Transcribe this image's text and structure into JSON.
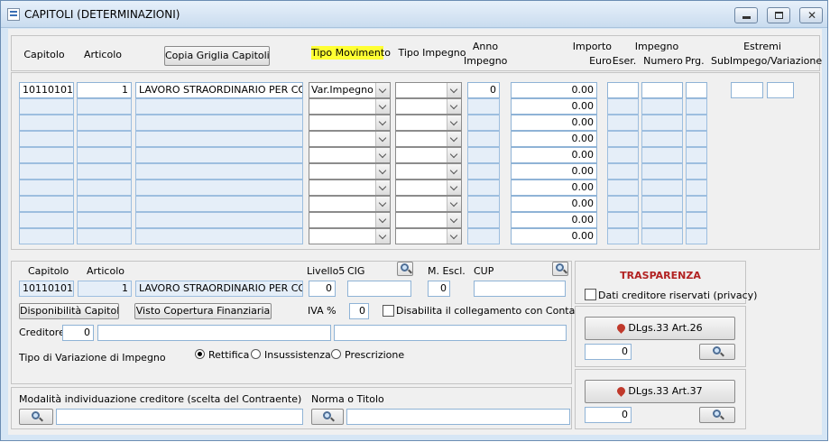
{
  "window": {
    "title": "CAPITOLI (DETERMINAZIONI)"
  },
  "grid_header": {
    "capitolo": "Capitolo",
    "articolo": "Articolo",
    "copia_btn": "Copia Griglia Capitoli",
    "tipo_movimento": "Tipo Movimento",
    "tipo_impegno": "Tipo Impegno",
    "anno": "Anno",
    "impegno": "Impegno",
    "importo": "Importo",
    "euro": "Euro",
    "impegno_group": "Impegno",
    "eser": "Eser.",
    "numero": "Numero",
    "prg": "Prg.",
    "estremi": "Estremi",
    "sub": "SubImpego/Variazione"
  },
  "grid_rows": [
    {
      "capitolo": "10110101",
      "articolo": "1",
      "descr": "LAVORO STRAORDINARIO PER CONS",
      "tipo_mov": "Var.Impegno",
      "tipo_imp": "",
      "anno": "0",
      "importo": "0.00"
    },
    {
      "capitolo": "",
      "articolo": "",
      "descr": "",
      "tipo_mov": "",
      "tipo_imp": "",
      "anno": "",
      "importo": "0.00"
    },
    {
      "capitolo": "",
      "articolo": "",
      "descr": "",
      "tipo_mov": "",
      "tipo_imp": "",
      "anno": "",
      "importo": "0.00"
    },
    {
      "capitolo": "",
      "articolo": "",
      "descr": "",
      "tipo_mov": "",
      "tipo_imp": "",
      "anno": "",
      "importo": "0.00"
    },
    {
      "capitolo": "",
      "articolo": "",
      "descr": "",
      "tipo_mov": "",
      "tipo_imp": "",
      "anno": "",
      "importo": "0.00"
    },
    {
      "capitolo": "",
      "articolo": "",
      "descr": "",
      "tipo_mov": "",
      "tipo_imp": "",
      "anno": "",
      "importo": "0.00"
    },
    {
      "capitolo": "",
      "articolo": "",
      "descr": "",
      "tipo_mov": "",
      "tipo_imp": "",
      "anno": "",
      "importo": "0.00"
    },
    {
      "capitolo": "",
      "articolo": "",
      "descr": "",
      "tipo_mov": "",
      "tipo_imp": "",
      "anno": "",
      "importo": "0.00"
    },
    {
      "capitolo": "",
      "articolo": "",
      "descr": "",
      "tipo_mov": "",
      "tipo_imp": "",
      "anno": "",
      "importo": "0.00"
    },
    {
      "capitolo": "",
      "articolo": "",
      "descr": "",
      "tipo_mov": "",
      "tipo_imp": "",
      "anno": "",
      "importo": "0.00"
    }
  ],
  "detail": {
    "capitolo_label": "Capitolo",
    "articolo_label": "Articolo",
    "capitolo": "10110101",
    "articolo": "1",
    "descr": "LAVORO STRAORDINARIO PER CONS",
    "livello5_label": "Livello5",
    "livello5": "0",
    "cig_label": "CIG",
    "cig": "",
    "mescl_label": "M. Escl.",
    "mescl": "0",
    "cup_label": "CUP",
    "cup": "",
    "disp_btn": "Disponibilità Capitolo",
    "visto_btn": "Visto Copertura Finanziaria",
    "iva_label": "IVA %",
    "iva": "0",
    "disabilita_label": "Disabilita il collegamento con Contabilità",
    "creditore_label": "Creditore",
    "creditore": "0",
    "tipo_var_label": "Tipo di Variazione di Impegno",
    "radio_rettifica": "Rettifica",
    "radio_insussistenza": "Insussistenza",
    "radio_prescrizione": "Prescrizione"
  },
  "bottom": {
    "modalita_label": "Modalità individuazione creditore (scelta del Contraente)",
    "norma_label": "Norma o Titolo"
  },
  "trasparenza": {
    "title": "TRASPARENZA",
    "privacy_label": "Dati creditore riservati (privacy)",
    "dlgs26": "DLgs.33 Art.26",
    "dlgs26_value": "0",
    "dlgs37": "DLgs.33 Art.37",
    "dlgs37_value": "0"
  },
  "colors": {
    "highlight": "#ffff33",
    "trasparenza_title": "#b22222",
    "cell_border": "#8fb3d6"
  }
}
